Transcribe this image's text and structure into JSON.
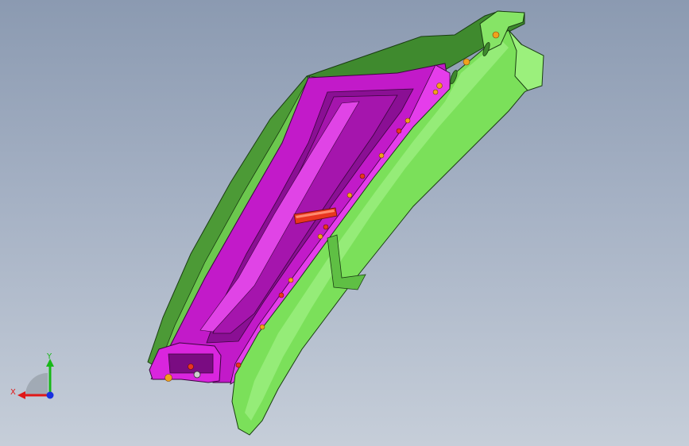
{
  "viewport": {
    "background_top": "#8b9ab1",
    "background_bottom": "#c6ced9"
  },
  "model": {
    "colors": {
      "green_part": "#7be05a",
      "green_dark": "#3f8a2e",
      "magenta_part": "#d91fe0",
      "magenta_dark": "#8a0f94",
      "pin": "#e8361f",
      "fastener": "#f0a21c"
    }
  },
  "triad": {
    "x_label": "X",
    "y_label": "Y",
    "x_color": "#e01818",
    "y_color": "#18b818",
    "z_color": "#1830e0"
  }
}
